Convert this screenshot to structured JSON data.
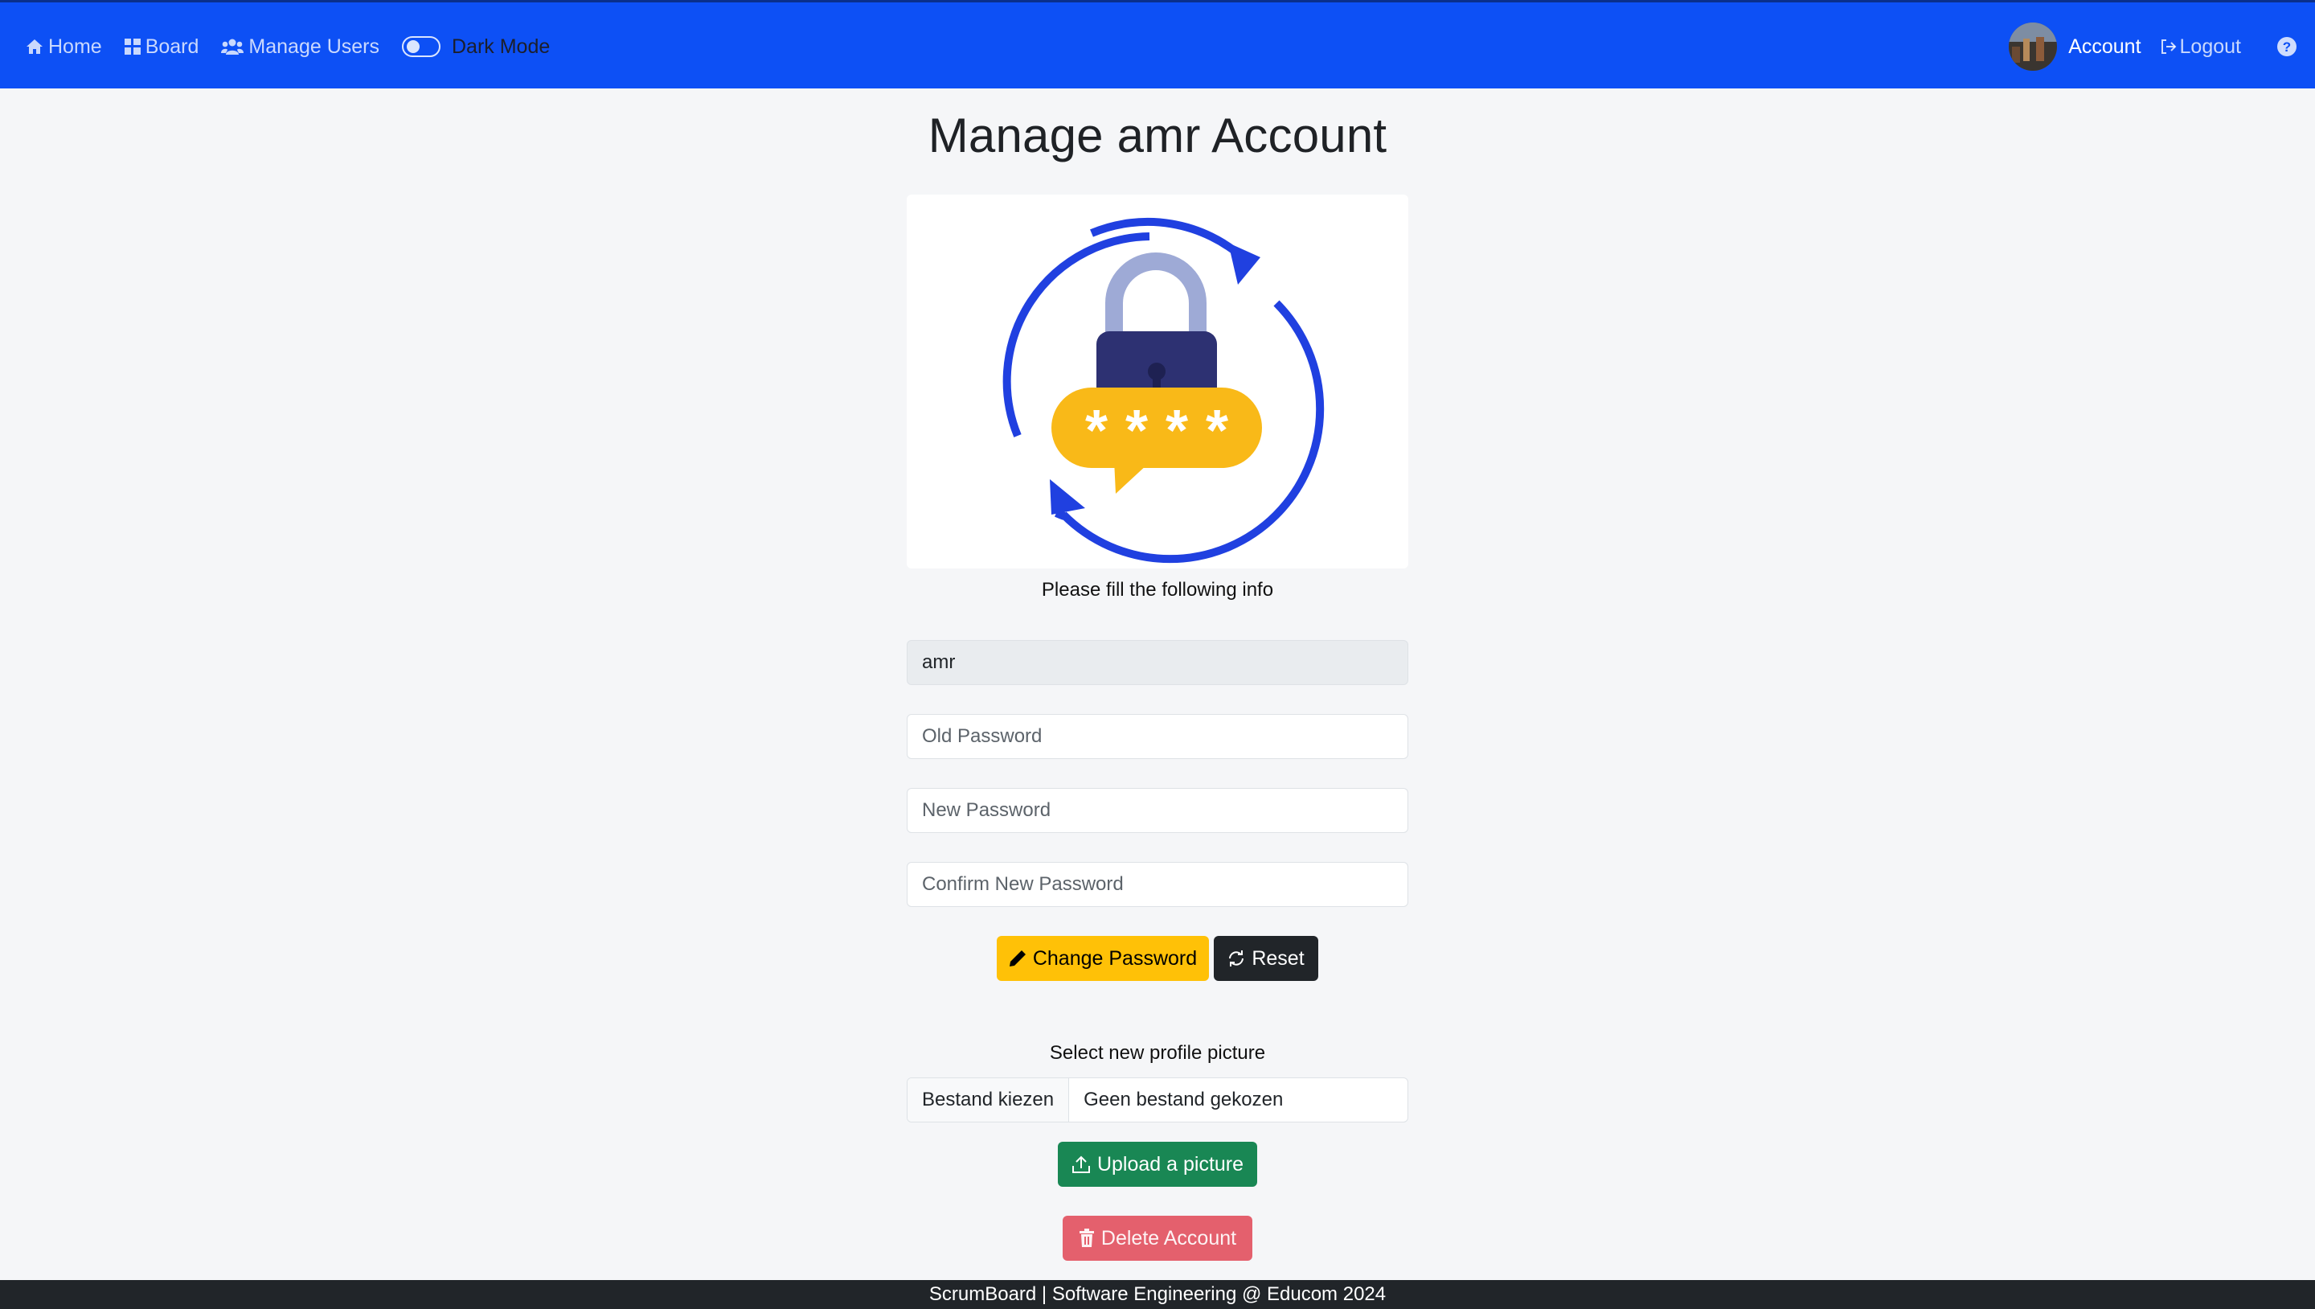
{
  "nav": {
    "home": "Home",
    "board": "Board",
    "manage_users": "Manage Users",
    "dark_mode": "Dark Mode",
    "account": "Account",
    "logout": "Logout"
  },
  "colors": {
    "navbar": "#0d50f5",
    "warning": "#ffc107",
    "dark": "#212529",
    "success": "#198754",
    "danger": "#e4606d",
    "illustration_blue": "#2040e0",
    "illustration_yellow": "#f9b918",
    "illustration_navy": "#2d3172",
    "illustration_shackle": "#9eaad6"
  },
  "page": {
    "title": "Manage amr Account",
    "subtitle": "Please fill the following info"
  },
  "form": {
    "username_value": "amr",
    "old_password_placeholder": "Old Password",
    "new_password_placeholder": "New Password",
    "confirm_password_placeholder": "Confirm New Password",
    "change_password_label": "Change Password",
    "reset_label": "Reset"
  },
  "profile": {
    "select_label": "Select new profile picture",
    "choose_file_label": "Bestand kiezen",
    "no_file_label": "Geen bestand gekozen",
    "upload_label": "Upload a picture",
    "delete_label": "Delete Account"
  },
  "footer": {
    "text": "ScrumBoard | Software Engineering @ Educom 2024"
  },
  "icons": {
    "home": "home-icon",
    "board": "grid-icon",
    "users": "users-icon",
    "logout": "sign-out-icon",
    "help": "question-circle-icon",
    "pencil": "pencil-icon",
    "reset": "arrow-repeat-icon",
    "upload": "upload-icon",
    "trash": "trash-icon"
  }
}
